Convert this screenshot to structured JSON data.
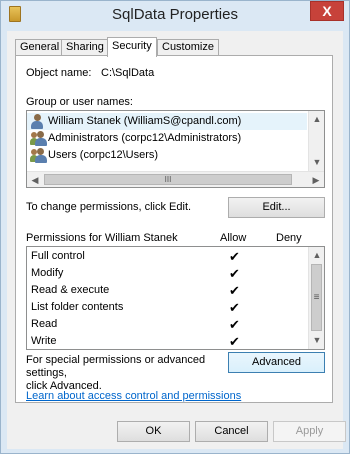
{
  "window": {
    "title": "SqlData Properties",
    "close_glyph": "X"
  },
  "tabs": [
    {
      "label": "General"
    },
    {
      "label": "Sharing"
    },
    {
      "label": "Security"
    },
    {
      "label": "Customize"
    }
  ],
  "security": {
    "object_name_label": "Object name:",
    "object_name_value": "C:\\SqlData",
    "group_label": "Group or user names:",
    "principals": [
      {
        "name": "William Stanek (WilliamS@cpandl.com)",
        "icon": "user-icon"
      },
      {
        "name": "Administrators (corpc12\\Administrators)",
        "icon": "group-icon"
      },
      {
        "name": "Users (corpc12\\Users)",
        "icon": "group-icon"
      }
    ],
    "hscroll_thumb_glyph": "III",
    "change_text": "To change permissions, click Edit.",
    "edit_button": "Edit...",
    "permissions_header": "Permissions for William Stanek",
    "allow_header": "Allow",
    "deny_header": "Deny",
    "permissions": [
      {
        "name": "Full control",
        "allow": true,
        "deny": false
      },
      {
        "name": "Modify",
        "allow": true,
        "deny": false
      },
      {
        "name": "Read & execute",
        "allow": true,
        "deny": false
      },
      {
        "name": "List folder contents",
        "allow": true,
        "deny": false
      },
      {
        "name": "Read",
        "allow": true,
        "deny": false
      },
      {
        "name": "Write",
        "allow": true,
        "deny": false
      }
    ],
    "check_glyph": "✔",
    "vscroll_thumb_glyph": "≡",
    "advanced_text": "For special permissions or advanced settings, click Advanced.",
    "advanced_line1": "For special permissions or advanced settings,",
    "advanced_line2": "click Advanced.",
    "advanced_button": "Advanced",
    "learn_link": "Learn about access control and permissions"
  },
  "footer": {
    "ok": "OK",
    "cancel": "Cancel",
    "apply": "Apply"
  }
}
